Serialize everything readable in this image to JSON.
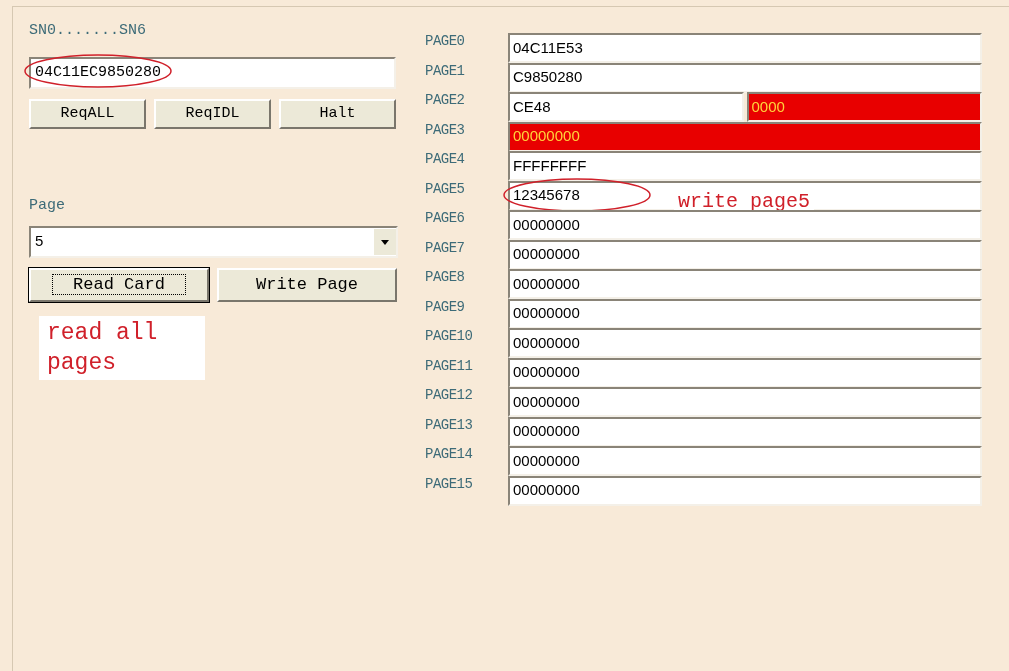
{
  "serial": {
    "label": "SN0.......SN6",
    "value": "04C11EC9850280",
    "circled": true
  },
  "request_buttons": [
    "ReqALL",
    "ReqIDL",
    "Halt"
  ],
  "page_select": {
    "label": "Page",
    "value": "5"
  },
  "action_buttons": [
    {
      "label": "Read Card",
      "focused": true
    },
    {
      "label": "Write Page",
      "focused": false
    }
  ],
  "note_left": "read all pages",
  "pages": [
    {
      "label": "PAGE0",
      "cells": [
        {
          "value": "04C11E53",
          "highlighted": false
        }
      ]
    },
    {
      "label": "PAGE1",
      "cells": [
        {
          "value": "C9850280",
          "highlighted": false
        }
      ]
    },
    {
      "label": "PAGE2",
      "cells": [
        {
          "value": "CE48",
          "highlighted": false
        },
        {
          "value": "0000",
          "highlighted": true
        }
      ]
    },
    {
      "label": "PAGE3",
      "cells": [
        {
          "value": "00000000",
          "highlighted": true
        }
      ]
    },
    {
      "label": "PAGE4",
      "cells": [
        {
          "value": "FFFFFFFF",
          "highlighted": false
        }
      ]
    },
    {
      "label": "PAGE5",
      "cells": [
        {
          "value": "12345678",
          "highlighted": false
        }
      ],
      "circled": true,
      "note": "write page5"
    },
    {
      "label": "PAGE6",
      "cells": [
        {
          "value": "00000000",
          "highlighted": false
        }
      ]
    },
    {
      "label": "PAGE7",
      "cells": [
        {
          "value": "00000000",
          "highlighted": false
        }
      ]
    },
    {
      "label": "PAGE8",
      "cells": [
        {
          "value": "00000000",
          "highlighted": false
        }
      ]
    },
    {
      "label": "PAGE9",
      "cells": [
        {
          "value": "00000000",
          "highlighted": false
        }
      ]
    },
    {
      "label": "PAGE10",
      "cells": [
        {
          "value": "00000000",
          "highlighted": false
        }
      ]
    },
    {
      "label": "PAGE11",
      "cells": [
        {
          "value": "00000000",
          "highlighted": false
        }
      ]
    },
    {
      "label": "PAGE12",
      "cells": [
        {
          "value": "00000000",
          "highlighted": false
        }
      ]
    },
    {
      "label": "PAGE13",
      "cells": [
        {
          "value": "00000000",
          "highlighted": false
        }
      ]
    },
    {
      "label": "PAGE14",
      "cells": [
        {
          "value": "00000000",
          "highlighted": false
        }
      ]
    },
    {
      "label": "PAGE15",
      "cells": [
        {
          "value": "00000000",
          "highlighted": false
        }
      ]
    }
  ]
}
